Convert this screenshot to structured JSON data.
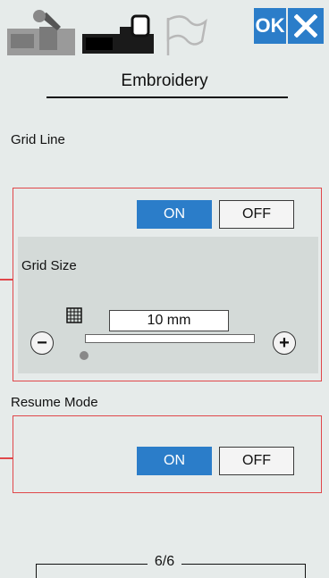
{
  "toolbar": {
    "tabs": [
      {
        "icon": "wrench-sewing-machine-icon"
      },
      {
        "icon": "embroidery-machine-icon",
        "active": true
      },
      {
        "icon": "flag-icon"
      }
    ],
    "ok_label": "OK",
    "close_icon": "close-x-icon"
  },
  "header": {
    "title": "Embroidery"
  },
  "grid_line": {
    "label": "Grid Line",
    "on_label": "ON",
    "off_label": "OFF",
    "selected": "ON",
    "grid_size": {
      "label": "Grid Size",
      "value": "10  mm",
      "slider_fraction": 0.0
    }
  },
  "resume_mode": {
    "label": "Resume Mode",
    "on_label": "ON",
    "off_label": "OFF",
    "selected": "ON"
  },
  "pagination": {
    "text": "6/6"
  },
  "colors": {
    "accent": "#2b7dc9",
    "highlight_box": "#e0474a",
    "panel_bg": "#e6ebea"
  }
}
